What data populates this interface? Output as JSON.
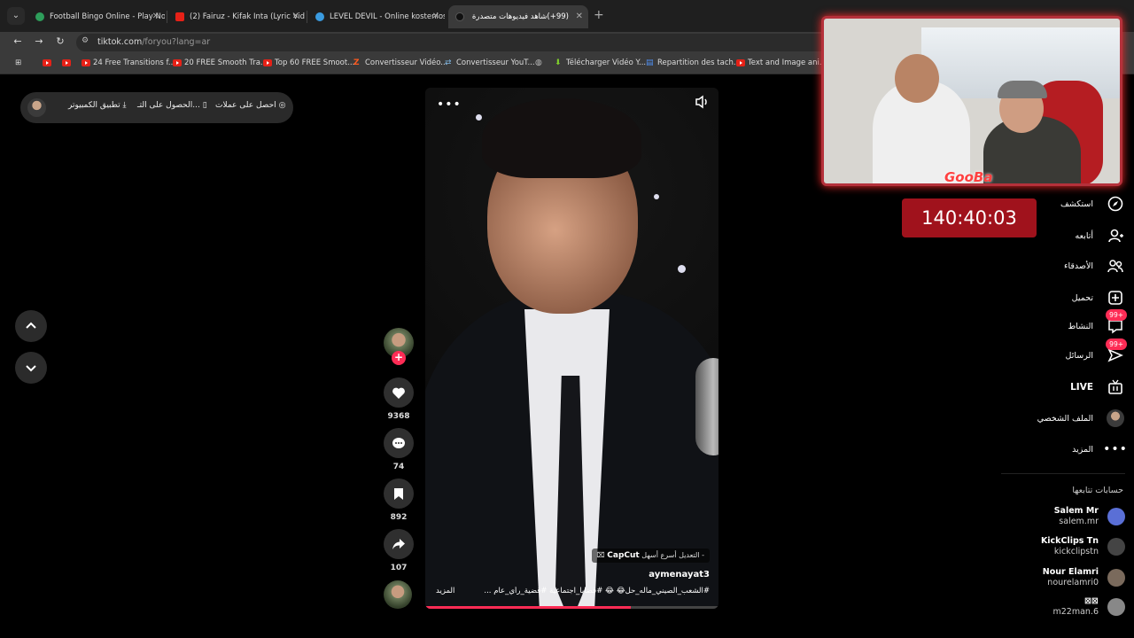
{
  "browser": {
    "tabs": [
      {
        "title": "Football Bingo Online - Play No",
        "favicon_color": "#2e9e5b"
      },
      {
        "title": "(2) Fairuz - Kifak Inta (Lyric Vide",
        "favicon_color": "#e62117"
      },
      {
        "title": "LEVEL DEVIL - Online kostenlos",
        "favicon_color": "#3a9be0"
      },
      {
        "title": "(99+)شاهد فيديوهات متصدرة | ",
        "favicon_color": "#111111"
      }
    ],
    "url_host": "tiktok.com",
    "url_path": "/foryou?lang=ar",
    "bookmarks": [
      {
        "label": "",
        "icon": "youtube-icon"
      },
      {
        "label": "",
        "icon": "youtube-icon"
      },
      {
        "label": "24 Free Transitions f...",
        "icon": "youtube-icon"
      },
      {
        "label": "20 FREE Smooth Tra...",
        "icon": "youtube-icon"
      },
      {
        "label": "Top 60 FREE Smoot...",
        "icon": "youtube-icon"
      },
      {
        "label": "Convertisseur Vidéo...",
        "icon": "z-icon"
      },
      {
        "label": "Convertisseur YouT...",
        "icon": "converter-icon"
      },
      {
        "label": "",
        "icon": "globe-icon"
      },
      {
        "label": "Télécharger Vidéo Y...",
        "icon": "download-arrow-icon"
      },
      {
        "label": "Repartition des tach...",
        "icon": "docs-icon"
      },
      {
        "label": "Text and Image ani...",
        "icon": "youtube-icon"
      }
    ]
  },
  "header_pill": {
    "coins": "احصل على عملات",
    "get_app": "الحصول على التـ...",
    "desktop_app": "تطبيق الكمبيوتر"
  },
  "video": {
    "more": "•••",
    "capcut_brand": "CapCut",
    "capcut_text": "التعديل أسرع أسهل -",
    "username": "aymenayat3",
    "caption": "#الشعب_الصيني_ماله_حل😂 😂  #قضايا_اجتماعية  #قضية_رأي_عام  ...",
    "more_label": "المزيد",
    "progress": 0.7
  },
  "actions": {
    "likes": "9368",
    "comments": "74",
    "saves": "892",
    "shares": "107"
  },
  "overlay": {
    "timer": "140:40:03",
    "logo": "GooBa"
  },
  "sidebar": {
    "explore": "استكشف",
    "following": "أتابعه",
    "friends": "الأصدقاء",
    "upload": "تحميل",
    "activity": "النشاط",
    "activity_badge": "99+",
    "messages": "الرسائل",
    "messages_badge": "99+",
    "live": "LIVE",
    "profile": "الملف الشخصي",
    "more": "المزيد",
    "following_header": "حسابات تتابعها",
    "accounts": [
      {
        "name": "Salem Mr",
        "handle": "salem.mr",
        "color": "#5a6fd6"
      },
      {
        "name": "KickClips Tn",
        "handle": "kickclipstn",
        "color": "#444"
      },
      {
        "name": "Nour Elamri",
        "handle": "nourelamri0",
        "color": "#7a6a5c"
      },
      {
        "name": "⊠⊠",
        "handle": "m22man.6",
        "color": "#888"
      }
    ]
  }
}
